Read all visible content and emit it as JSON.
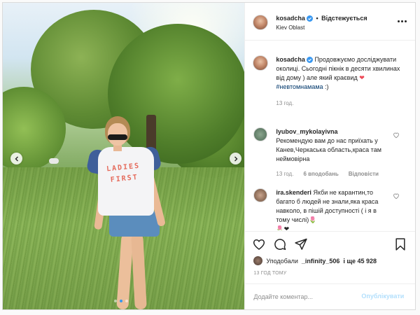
{
  "post": {
    "author": {
      "username": "kosadcha",
      "verified": true,
      "follow_state": "Відстежується",
      "location": "Kiev Oblast"
    },
    "photo": {
      "shirt_text_line1": "LADIES",
      "shirt_text_line2": "FIRST",
      "carousel_total": 3,
      "carousel_active_index": 1
    },
    "caption": {
      "username": "kosadcha",
      "text": "Продовжуємо досліджувати околиці. Сьогодні пікнік в десяти хвилинах від дому ) але який краєвид ",
      "emoji_after_text": "❤",
      "hashtag": "#невтомнамама",
      "suffix": " :)",
      "time": "13 год."
    },
    "comments": [
      {
        "username": "lyubov_mykolayivna",
        "text": "Рекомендую вам до нас приїхать у Канев,Черкаська область,краса там неймовірна",
        "time": "13 год.",
        "likes": "6 вподобань",
        "reply": "Відповісти"
      },
      {
        "username": "ira.skenderi",
        "text": "Якби не карантин,то багато б людей не знали,яка краса навколо, в пішій доступності ( і я в тому числі)",
        "emoji_line": "🌷",
        "emoji_line2": "🌷❤"
      }
    ],
    "likes": {
      "prefix": "Уподобали",
      "user": "_infinity_506",
      "suffix": "і ще 45 928"
    },
    "timestamp": "13 ГОД ТОМУ",
    "add_comment": {
      "placeholder": "Додайте коментар...",
      "publish_label": "Опублікувати"
    }
  },
  "colors": {
    "verified_blue": "#3897f0",
    "heart_red": "#ed4956",
    "link_dark_blue": "#00376b",
    "publish_disabled": "#b2dffc"
  },
  "icons": [
    "chevron-left-icon",
    "chevron-right-icon",
    "verified-badge-icon",
    "more-icon",
    "heart-icon",
    "comment-icon",
    "share-icon",
    "bookmark-icon"
  ]
}
